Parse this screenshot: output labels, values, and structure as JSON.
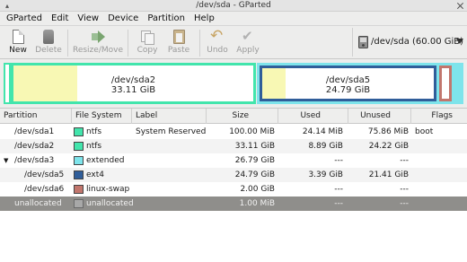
{
  "window": {
    "title": "/dev/sda - GParted"
  },
  "menu": [
    "GParted",
    "Edit",
    "View",
    "Device",
    "Partition",
    "Help"
  ],
  "toolbar": {
    "new": "New",
    "delete": "Delete",
    "resize_move": "Resize/Move",
    "copy": "Copy",
    "paste": "Paste",
    "undo": "Undo",
    "apply": "Apply"
  },
  "device_selector": {
    "value": "/dev/sda   (60.00 GiB)"
  },
  "disk_map": {
    "sda2": {
      "name": "/dev/sda2",
      "size": "33.11 GiB",
      "used_fraction": 0.27
    },
    "sda5": {
      "name": "/dev/sda5",
      "size": "24.79 GiB",
      "used_fraction": 0.14
    }
  },
  "table": {
    "columns": [
      "Partition",
      "File System",
      "Label",
      "Size",
      "Used",
      "Unused",
      "Flags"
    ],
    "rows": [
      {
        "partition": "/dev/sda1",
        "fs": "ntfs",
        "fs_color": "#42e5ac",
        "label": "System Reserved",
        "size": "100.00 MiB",
        "used": "24.14 MiB",
        "unused": "75.86 MiB",
        "flags": "boot"
      },
      {
        "partition": "/dev/sda2",
        "fs": "ntfs",
        "fs_color": "#42e5ac",
        "label": "",
        "size": "33.11 GiB",
        "used": "8.89 GiB",
        "unused": "24.22 GiB",
        "flags": ""
      },
      {
        "partition": "/dev/sda3",
        "fs": "extended",
        "fs_color": "#7ee4eb",
        "label": "",
        "size": "26.79 GiB",
        "used": "---",
        "unused": "---",
        "flags": ""
      },
      {
        "partition": "/dev/sda5",
        "fs": "ext4",
        "fs_color": "#305e9a",
        "label": "",
        "size": "24.79 GiB",
        "used": "3.39 GiB",
        "unused": "21.41 GiB",
        "flags": ""
      },
      {
        "partition": "/dev/sda6",
        "fs": "linux-swap",
        "fs_color": "#c2766d",
        "label": "",
        "size": "2.00 GiB",
        "used": "---",
        "unused": "---",
        "flags": ""
      },
      {
        "partition": "unallocated",
        "fs": "unallocated",
        "fs_color": "#a8a8a8",
        "label": "",
        "size": "1.00 MiB",
        "used": "---",
        "unused": "---",
        "flags": ""
      }
    ]
  },
  "colors": {
    "ntfs": "#42e5ac",
    "extended": "#7ee4eb",
    "ext4": "#305e9a",
    "linux_swap": "#c2766d",
    "used_fill": "#f8f8b4",
    "selected_row": "#8f8e8b"
  }
}
